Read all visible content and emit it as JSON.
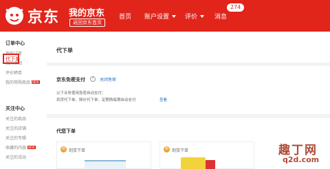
{
  "header": {
    "logo_text": "京东",
    "my_jd": "我的京东",
    "back_home": "返回京东首页",
    "nav": [
      "首页",
      "账户设置",
      "评价",
      "消息"
    ],
    "msg_count": "274"
  },
  "sidebar": {
    "order_center_title": "订单中心",
    "order_items": [
      "我的订单",
      "我的活动",
      "评价晒单",
      "我的常购商品"
    ],
    "new_tag": "NEW",
    "active_item": "代下单",
    "follow_center_title": "关注中心",
    "follow_items": [
      "关注的商品",
      "关注的店铺",
      "关注的专辑",
      "收藏的内容",
      "关注的活动"
    ]
  },
  "main": {
    "page_title": "代下单",
    "pay_title": "京东免密支付",
    "pay_close": "关闭免密",
    "pay_desc1": "以下业务使用免密自动支付：",
    "pay_desc2": "到货代下单、降价代下单、定期购每期自动支付",
    "pay_view": "查看",
    "order_section_title": "代您下单",
    "cards": [
      {
        "badge": "到",
        "label": "到货下单"
      },
      {
        "badge": "到",
        "label": "到货下单"
      }
    ]
  },
  "watermark": {
    "cn": "趣丁网",
    "en": "q2d.com"
  }
}
